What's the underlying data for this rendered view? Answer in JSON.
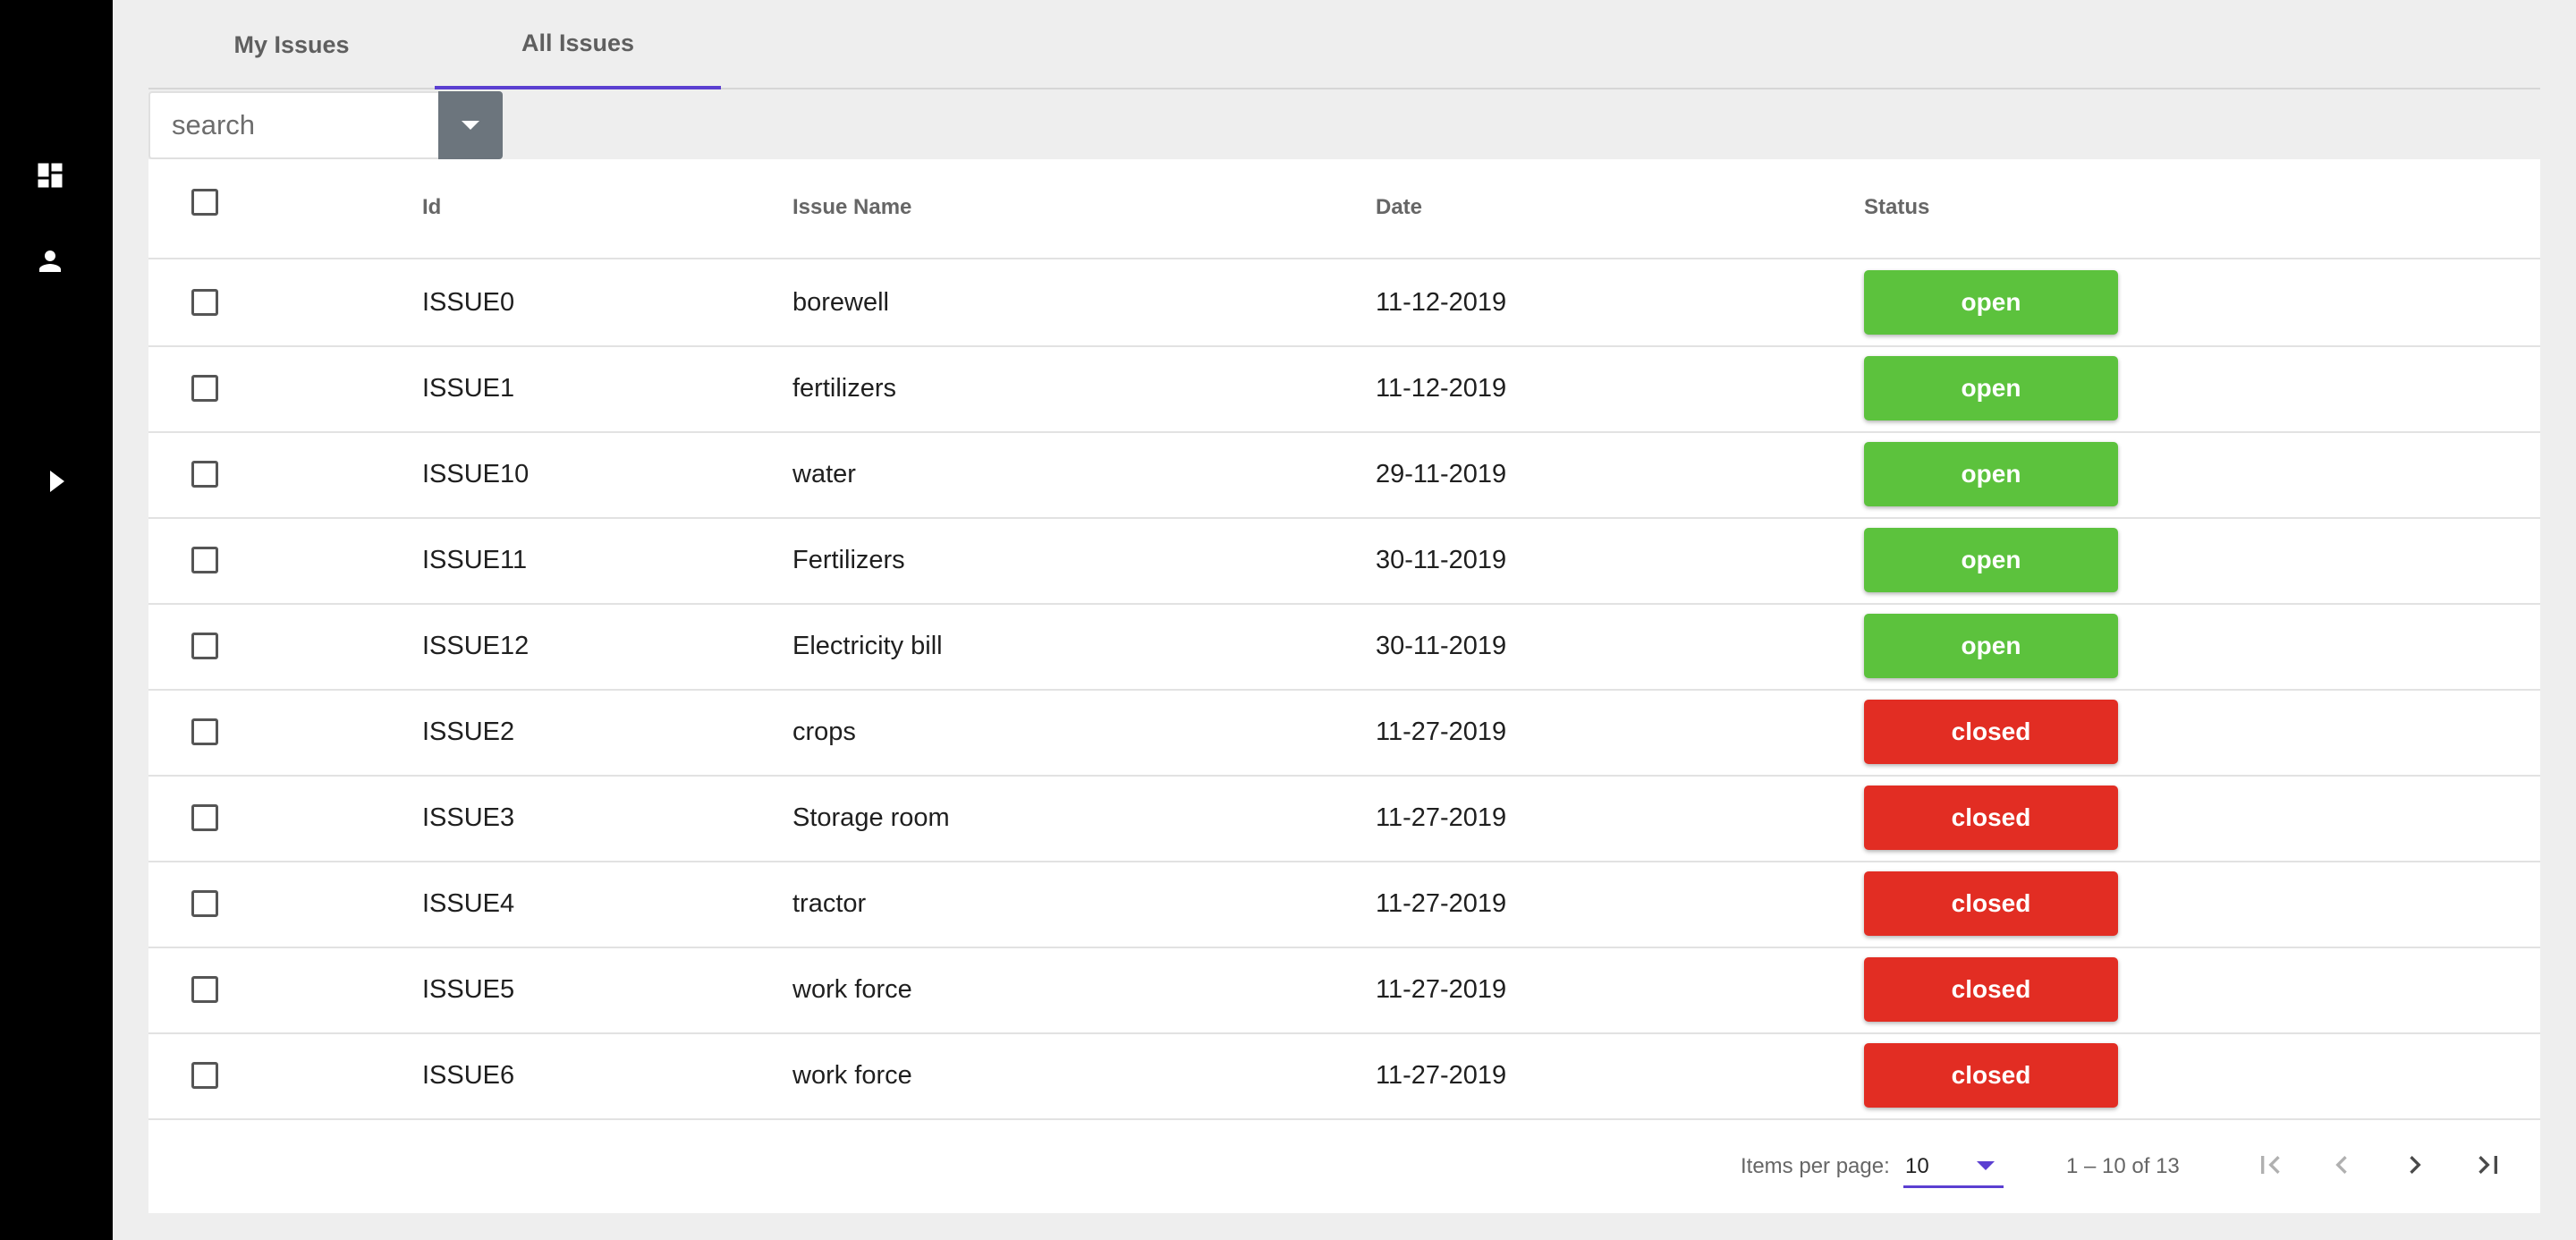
{
  "sidebar": {
    "icons": [
      "dashboard-icon",
      "person-icon",
      "expand-arrow-icon"
    ]
  },
  "tabs": [
    {
      "label": "My Issues",
      "active": false
    },
    {
      "label": "All Issues",
      "active": true
    }
  ],
  "search": {
    "placeholder": "search",
    "value": "",
    "dropdown_icon": "caret-down-icon"
  },
  "table": {
    "columns": {
      "id": "Id",
      "name": "Issue Name",
      "date": "Date",
      "status": "Status"
    },
    "rows": [
      {
        "id": "ISSUE0",
        "name": "borewell",
        "date": "11-12-2019",
        "status": "open"
      },
      {
        "id": "ISSUE1",
        "name": "fertilizers",
        "date": "11-12-2019",
        "status": "open"
      },
      {
        "id": "ISSUE10",
        "name": "water",
        "date": "29-11-2019",
        "status": "open"
      },
      {
        "id": "ISSUE11",
        "name": "Fertilizers",
        "date": "30-11-2019",
        "status": "open"
      },
      {
        "id": "ISSUE12",
        "name": "Electricity bill",
        "date": "30-11-2019",
        "status": "open"
      },
      {
        "id": "ISSUE2",
        "name": "crops",
        "date": "11-27-2019",
        "status": "closed"
      },
      {
        "id": "ISSUE3",
        "name": "Storage room",
        "date": "11-27-2019",
        "status": "closed"
      },
      {
        "id": "ISSUE4",
        "name": "tractor",
        "date": "11-27-2019",
        "status": "closed"
      },
      {
        "id": "ISSUE5",
        "name": "work force",
        "date": "11-27-2019",
        "status": "closed"
      },
      {
        "id": "ISSUE6",
        "name": "work force",
        "date": "11-27-2019",
        "status": "closed"
      }
    ]
  },
  "paginator": {
    "items_per_page_label": "Items per page:",
    "items_per_page_value": "10",
    "range_label": "1 – 10 of 13"
  },
  "colors": {
    "sidebar_bg": "#000000",
    "accent": "#5b3fd1",
    "status_open": "#5cc23d",
    "status_closed": "#e22d23",
    "search_button": "#6c757d"
  }
}
